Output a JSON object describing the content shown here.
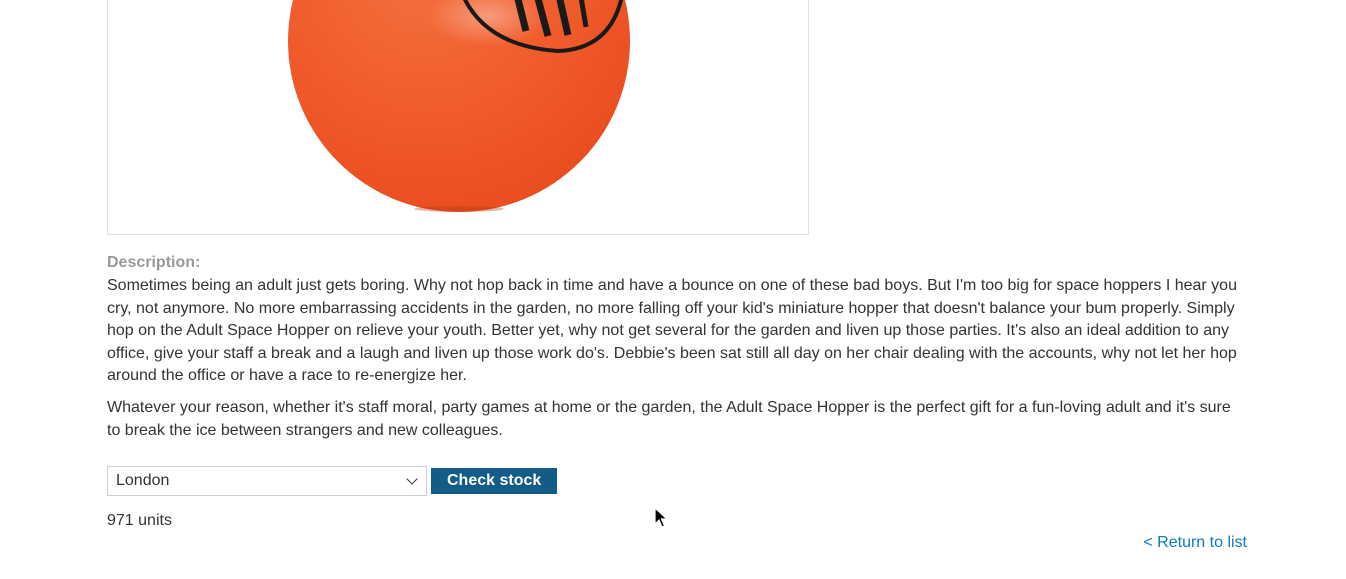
{
  "product": {
    "image_alt": "Adult Space Hopper",
    "description_label": "Description:",
    "description_paragraphs": [
      "Sometimes being an adult just gets boring. Why not hop back in time and have a bounce on one of these bad boys. But I'm too big for space hoppers I hear you cry, not anymore. No more embarrassing accidents in the garden, no more falling off your kid's miniature hopper that doesn't balance your bum properly. Simply hop on the Adult Space Hopper on relieve your youth. Better yet, why not get several for the garden and liven up those parties. It's also an ideal addition to any office, give your staff a break and a laugh and liven up those work do's. Debbie's been sat still all day on her chair dealing with the accounts, why not let her hop around the office or have a race to re-energize her.",
      "Whatever your reason, whether it's staff moral, party games at home or the garden, the Adult Space Hopper is the perfect gift for a fun-loving adult and it's sure to break the ice between strangers and new colleagues."
    ]
  },
  "stock_check": {
    "selected_store": "London",
    "button_label": "Check stock",
    "result": "971 units"
  },
  "navigation": {
    "return_link": "< Return to list"
  },
  "colors": {
    "accent_button": "#135c87",
    "link": "#0e79c0",
    "label_gray": "#999999",
    "ball_orange": "#f26a3a"
  },
  "icons": {
    "select_arrow": "chevron-down-icon",
    "cursor": "mouse-pointer-icon"
  }
}
